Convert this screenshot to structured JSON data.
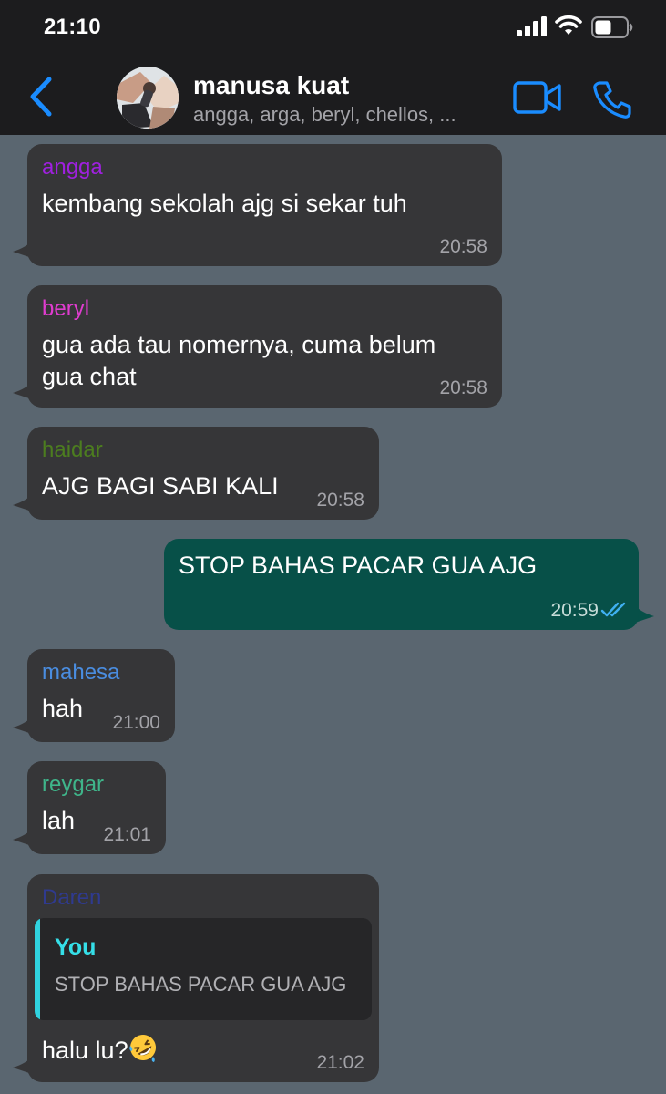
{
  "status_bar": {
    "time": "21:10"
  },
  "header": {
    "title": "manusa kuat",
    "subtitle": "angga, arga, beryl, chellos, ..."
  },
  "messages": [
    {
      "sender": "angga",
      "sender_color": "#a020e0",
      "text": "kembang sekolah ajg si sekar tuh",
      "time": "20:58"
    },
    {
      "sender": "beryl",
      "sender_color": "#e03ccf",
      "text_line1": "gua ada tau nomernya, cuma belum",
      "text_line2": "gua chat",
      "time": "20:58"
    },
    {
      "sender": "haidar",
      "sender_color": "#4c7d1f",
      "text": "AJG BAGI SABI KALI",
      "time": "20:58"
    },
    {
      "direction": "outgoing",
      "text": "STOP BAHAS PACAR GUA AJG",
      "time": "20:59",
      "status": "read"
    },
    {
      "sender": "mahesa",
      "sender_color": "#4a8de0",
      "text": "hah",
      "time": "21:00"
    },
    {
      "sender": "reygar",
      "sender_color": "#3fb58a",
      "text": "lah",
      "time": "21:01"
    },
    {
      "sender": "Daren",
      "sender_color": "#2f3a8f",
      "quote": {
        "author": "You",
        "text": "STOP BAHAS PACAR GUA AJG"
      },
      "text": "halu lu?",
      "emoji": "rofl",
      "time": "21:02"
    }
  ],
  "colors": {
    "chat_background": "#5a6670",
    "incoming_bubble": "#363638",
    "outgoing_bubble": "#075048",
    "accent": "#1a8cff",
    "read_ticks": "#3fb0f0"
  }
}
